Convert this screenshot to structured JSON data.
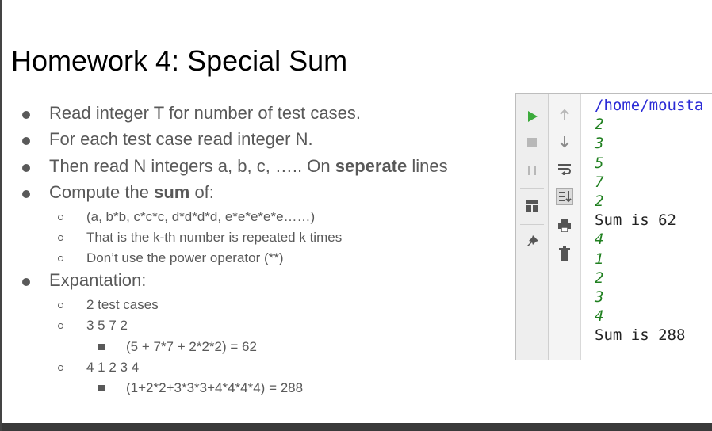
{
  "slide": {
    "title": "Homework 4: Special Sum",
    "bullets": {
      "b1": "Read integer T for number of test cases.",
      "b2": "For each test case read integer N.",
      "b3_pre": "Then read N integers a, b, c, ….. On ",
      "b3_bold": "seperate",
      "b3_post": " lines",
      "b4_pre": "Compute the ",
      "b4_bold": "sum",
      "b4_post": " of:",
      "s1": "(a, b*b, c*c*c, d*d*d*d, e*e*e*e*e……)",
      "s2": "That is the k-th number is repeated k times",
      "s3": "Don’t use the power operator (**)",
      "b5": "Expantation:",
      "s4": "2 test cases",
      "s5": "3  5 7 2",
      "t1": "(5 + 7*7 + 2*2*2)  = 62",
      "s6": "4  1 2 3 4",
      "t2": "(1+2*2+3*3*3+4*4*4*4) = 288"
    }
  },
  "console": {
    "lines": [
      {
        "text": "/home/mousta",
        "kind": "path"
      },
      {
        "text": "2",
        "kind": "input"
      },
      {
        "text": "3",
        "kind": "input"
      },
      {
        "text": "5",
        "kind": "input"
      },
      {
        "text": "7",
        "kind": "input"
      },
      {
        "text": "2",
        "kind": "input"
      },
      {
        "text": "Sum is 62",
        "kind": "output"
      },
      {
        "text": "4",
        "kind": "input"
      },
      {
        "text": "1",
        "kind": "input"
      },
      {
        "text": "2",
        "kind": "input"
      },
      {
        "text": "3",
        "kind": "input"
      },
      {
        "text": "4",
        "kind": "input"
      },
      {
        "text": "Sum is 288",
        "kind": "output"
      }
    ],
    "toolbar_icons": [
      "run-icon",
      "stop-icon",
      "pause-icon",
      "layout-icon",
      "pin-icon",
      "scroll-up-icon",
      "scroll-down-icon",
      "soft-wrap-icon",
      "scroll-to-end-icon",
      "print-icon",
      "trash-icon"
    ],
    "colors": {
      "path": "#2b2bd6",
      "input": "#208020",
      "output": "#222222",
      "run": "#3cab3c"
    }
  }
}
